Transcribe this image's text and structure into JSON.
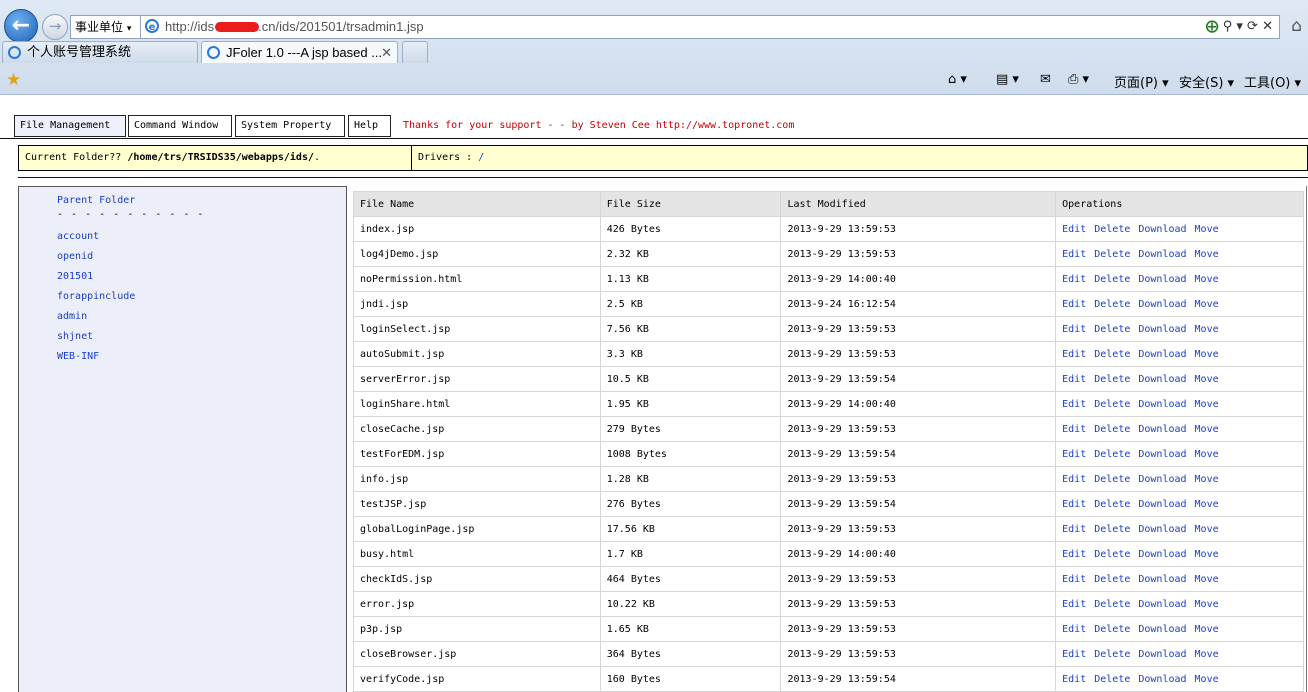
{
  "browser": {
    "zone_label": "事业单位",
    "url_prefix": "http://ids",
    "url_suffix": ".cn/ids/201501/trsadmin1.jsp",
    "address_tools": "⊕ ⚲ ▾ ⟳ ✕",
    "tabs": [
      {
        "label": "个人账号管理系统"
      },
      {
        "label": "JFoler 1.0 ---A jsp based ..."
      }
    ],
    "commands": {
      "page": "页面(P)",
      "safety": "安全(S)",
      "tools": "工具(O)"
    }
  },
  "menu": {
    "file_management": "File Management",
    "command_window": "Command Window",
    "system_property": "System Property",
    "help": "Help",
    "thanks": "Thanks for your support - - by Steven Cee http://www.topronet.com"
  },
  "folder": {
    "current_label": "Current Folder?? ",
    "current_path": "/home/trs/TRSIDS35/webapps/ids/",
    "current_tail": ".",
    "drivers_label": "Drivers : ",
    "drivers_value": "/"
  },
  "sidebar": {
    "parent_folder": "Parent Folder",
    "divider": "- - - - - - - - - - -",
    "folders": [
      "account",
      "openid",
      "201501",
      "forappinclude",
      "admin",
      "shjnet",
      "WEB-INF"
    ]
  },
  "table": {
    "headers": [
      "File Name",
      "File Size",
      "Last Modified",
      "Operations"
    ],
    "operations": [
      "Edit",
      "Delete",
      "Download",
      "Move"
    ],
    "rows": [
      [
        "index.jsp",
        "426 Bytes",
        "2013-9-29 13:59:53"
      ],
      [
        "log4jDemo.jsp",
        "2.32 KB",
        "2013-9-29 13:59:53"
      ],
      [
        "noPermission.html",
        "1.13 KB",
        "2013-9-29 14:00:40"
      ],
      [
        "jndi.jsp",
        "2.5 KB",
        "2013-9-24 16:12:54"
      ],
      [
        "loginSelect.jsp",
        "7.56 KB",
        "2013-9-29 13:59:53"
      ],
      [
        "autoSubmit.jsp",
        "3.3 KB",
        "2013-9-29 13:59:53"
      ],
      [
        "serverError.jsp",
        "10.5 KB",
        "2013-9-29 13:59:54"
      ],
      [
        "loginShare.html",
        "1.95 KB",
        "2013-9-29 14:00:40"
      ],
      [
        "closeCache.jsp",
        "279 Bytes",
        "2013-9-29 13:59:53"
      ],
      [
        "testForEDM.jsp",
        "1008 Bytes",
        "2013-9-29 13:59:54"
      ],
      [
        "info.jsp",
        "1.28 KB",
        "2013-9-29 13:59:53"
      ],
      [
        "testJSP.jsp",
        "276 Bytes",
        "2013-9-29 13:59:54"
      ],
      [
        "globalLoginPage.jsp",
        "17.56 KB",
        "2013-9-29 13:59:53"
      ],
      [
        "busy.html",
        "1.7 KB",
        "2013-9-29 14:00:40"
      ],
      [
        "checkIdS.jsp",
        "464 Bytes",
        "2013-9-29 13:59:53"
      ],
      [
        "error.jsp",
        "10.22 KB",
        "2013-9-29 13:59:53"
      ],
      [
        "p3p.jsp",
        "1.65 KB",
        "2013-9-29 13:59:53"
      ],
      [
        "closeBrowser.jsp",
        "364 Bytes",
        "2013-9-29 13:59:53"
      ],
      [
        "verifyCode.jsp",
        "160 Bytes",
        "2013-9-29 13:59:54"
      ]
    ]
  }
}
